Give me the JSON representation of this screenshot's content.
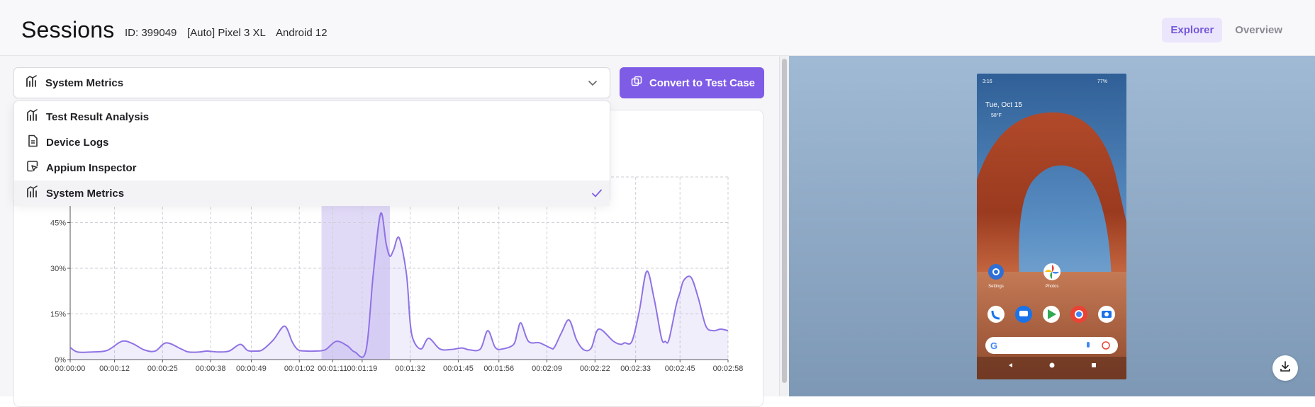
{
  "header": {
    "title": "Sessions",
    "session_id": "ID: 399049",
    "device": "[Auto] Pixel 3 XL",
    "os": "Android 12",
    "tabs": [
      {
        "label": "Explorer",
        "active": true
      },
      {
        "label": "Overview",
        "active": false
      }
    ]
  },
  "panel_select": {
    "selected": "System Metrics",
    "icon": "chart-icon",
    "options": [
      {
        "label": "Test Result Analysis",
        "icon": "chart-icon"
      },
      {
        "label": "Device Logs",
        "icon": "document-icon"
      },
      {
        "label": "Appium Inspector",
        "icon": "inspector-icon"
      },
      {
        "label": "System Metrics",
        "icon": "chart-icon",
        "selected": true
      }
    ]
  },
  "convert_button": {
    "label": "Convert to Test Case",
    "icon": "copy-icon"
  },
  "colors": {
    "accent": "#7f5ce6",
    "accent_light": "#ebe6fb",
    "line": "#8f72e4",
    "highlight": "#dcd3f6"
  },
  "chart_data": {
    "type": "area",
    "title": "",
    "xlabel": "",
    "ylabel": "",
    "ylim": [
      0,
      60
    ],
    "y_ticks": [
      "0%",
      "15%",
      "30%",
      "45%"
    ],
    "x_ticks": [
      "00:00:00",
      "00:00:12",
      "00:00:25",
      "00:00:38",
      "00:00:49",
      "00:01:02",
      "00:01:11",
      "00:01:19",
      "00:01:32",
      "00:01:45",
      "00:01:56",
      "00:02:09",
      "00:02:22",
      "00:02:33",
      "00:02:45",
      "00:02:58"
    ],
    "x_tick_seconds": [
      0,
      12,
      25,
      38,
      49,
      62,
      71,
      79,
      92,
      105,
      116,
      129,
      142,
      153,
      165,
      178
    ],
    "grid": true,
    "highlight_range_seconds": [
      68,
      86.5
    ],
    "series": [
      {
        "x": [
          0,
          2,
          6,
          10,
          14,
          17,
          20,
          23,
          26,
          30,
          32,
          35,
          37,
          40,
          43,
          46,
          48,
          50,
          52,
          55,
          58,
          60,
          61,
          62,
          64,
          66,
          69,
          72,
          75,
          77,
          80,
          82,
          84,
          85.5,
          86.5,
          87.5,
          89,
          91,
          92,
          93,
          95,
          97,
          100,
          103,
          106,
          108,
          111,
          113,
          115,
          117,
          120,
          121,
          122,
          124,
          127,
          130,
          131,
          133,
          135,
          137,
          139,
          141,
          143,
          147,
          149,
          150,
          152,
          154,
          156,
          158,
          160,
          161,
          162,
          164,
          165,
          166,
          168,
          170,
          172,
          174,
          176,
          178
        ],
        "y": [
          4,
          2.5,
          2.5,
          3,
          6,
          5.2,
          3.2,
          2.8,
          5.5,
          3.5,
          2.5,
          2.5,
          2.8,
          2.5,
          2.8,
          5,
          3,
          2.8,
          3.2,
          6.5,
          11,
          6,
          4,
          3,
          2.8,
          2.8,
          3.2,
          6,
          4.5,
          2.5,
          2.8,
          28,
          48,
          38,
          34,
          36,
          40,
          28,
          12,
          6,
          3.5,
          7,
          3.5,
          3.3,
          3.8,
          3.2,
          3.5,
          9.5,
          4,
          3.5,
          5,
          9,
          12,
          6,
          5.5,
          3.8,
          4,
          9,
          13,
          6.5,
          3.2,
          3.8,
          10,
          6,
          5,
          5.5,
          6,
          16,
          29,
          20,
          7,
          6,
          6.5,
          18,
          22,
          26,
          27,
          20,
          11,
          9.5,
          10,
          9.5
        ]
      }
    ]
  },
  "phone": {
    "status_time": "3:16",
    "battery": "77%",
    "date": "Tue, Oct 15",
    "weather": "58°F",
    "apps_top": [
      "Settings",
      "Photos"
    ],
    "dock": [
      "phone-icon",
      "messages-icon",
      "play-store-icon",
      "chrome-icon",
      "camera-icon"
    ]
  }
}
